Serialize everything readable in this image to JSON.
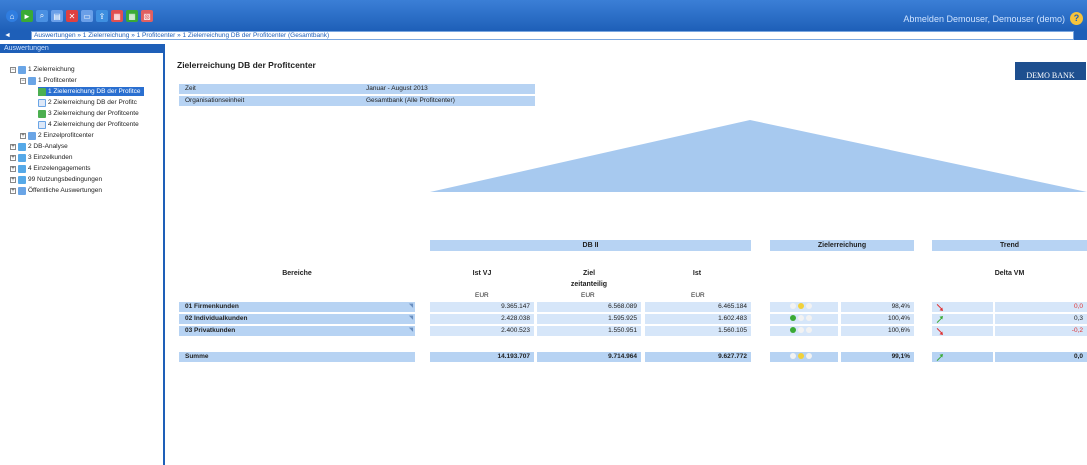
{
  "topbar": {
    "user_text": "Abmelden   Demouser, Demouser (demo)",
    "help_label": "?"
  },
  "navbar": {
    "back_label": "◄",
    "breadcrumb": "Auswertungen » 1 Zielerreichung » 1 Profitcenter » 1 Zielerreichung DB der Profitcenter (Gesamtbank)"
  },
  "sidebar": {
    "title": "Auswertungen",
    "items": [
      {
        "label": "1 Zielerreichung",
        "expander": "−",
        "icon": "folder"
      },
      {
        "label": "1 Profitcenter",
        "expander": "−",
        "icon": "folder"
      },
      {
        "label": "1 Zielerreichung DB der Profitce",
        "icon": "green"
      },
      {
        "label": "2 Zielerreichung DB der Profitc",
        "icon": "doc"
      },
      {
        "label": "3 Zielerreichung der Profitcente",
        "icon": "green"
      },
      {
        "label": "4 Zielerreichung der Profitcente",
        "icon": "doc"
      },
      {
        "label": "2 Einzelprofitcenter",
        "expander": "+",
        "icon": "folder"
      },
      {
        "label": "2 DB-Analyse",
        "expander": "+",
        "icon": "rep"
      },
      {
        "label": "3 Einzelkunden",
        "expander": "+",
        "icon": "rep"
      },
      {
        "label": "4 Einzelengagements",
        "expander": "+",
        "icon": "rep"
      },
      {
        "label": "99 Nutzungsbedingungen",
        "expander": "+",
        "icon": "rep"
      },
      {
        "label": "Öffentliche Auswertungen",
        "expander": "+",
        "icon": "folder"
      }
    ]
  },
  "main": {
    "title": "Zielerreichung DB der Profitcenter",
    "logo": "DEMO BANK",
    "info": [
      {
        "key": "Zeit",
        "value": "Januar - August 2013"
      },
      {
        "key": "Organisationseinheit",
        "value": "Gesamtbank (Alle Profitcenter)"
      }
    ],
    "group_headers": {
      "db": "DB II",
      "ziel": "Zielerreichung",
      "trend": "Trend"
    },
    "columns": {
      "bereiche": "Bereiche",
      "ist_vj": "Ist VJ",
      "ziel": "Ziel",
      "ziel_sub": "zeitanteilig",
      "ist": "Ist",
      "delta": "Delta VM",
      "unit": "EUR"
    },
    "rows": [
      {
        "name": "01  Firmenkunden",
        "ist_vj": "9.365.147",
        "ziel": "6.568.089",
        "ist": "6.465.184",
        "lamps": [
          "#f2f2f2",
          "#f1d13a",
          "#f2f2f2"
        ],
        "pct": "98,4%",
        "trend": "down",
        "delta": "0,0",
        "delta_color": "#e03030"
      },
      {
        "name": "02  Individualkunden",
        "ist_vj": "2.428.038",
        "ziel": "1.595.925",
        "ist": "1.602.483",
        "lamps": [
          "#3aaa35",
          "#f2f2f2",
          "#f2f2f2"
        ],
        "pct": "100,4%",
        "trend": "up",
        "delta": "0,3",
        "delta_color": "#222222"
      },
      {
        "name": "03  Privatkunden",
        "ist_vj": "2.400.523",
        "ziel": "1.550.951",
        "ist": "1.560.105",
        "lamps": [
          "#3aaa35",
          "#f2f2f2",
          "#f2f2f2"
        ],
        "pct": "100,6%",
        "trend": "down",
        "delta": "-0,2",
        "delta_color": "#e03030"
      }
    ],
    "summe": {
      "name": "Summe",
      "ist_vj": "14.193.707",
      "ziel": "9.714.964",
      "ist": "9.627.772",
      "lamps": [
        "#f2f2f2",
        "#f1d13a",
        "#f2f2f2"
      ],
      "pct": "99,1%",
      "trend": "up",
      "delta": "0,0",
      "delta_color": "#222222"
    }
  }
}
